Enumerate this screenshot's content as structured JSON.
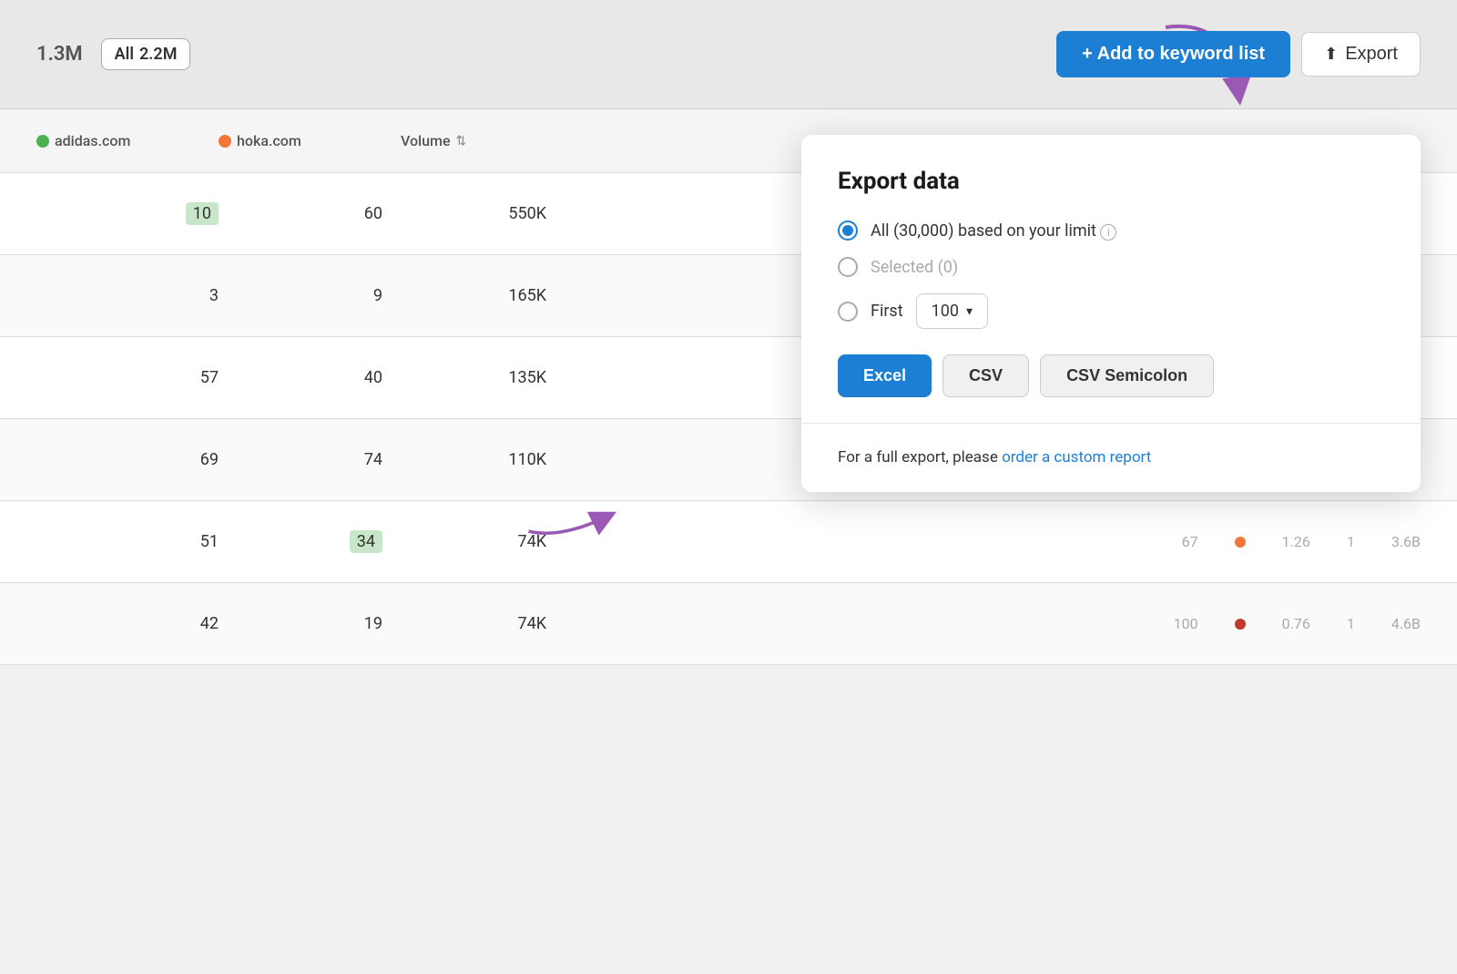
{
  "topbar": {
    "filter_count": "1.3M",
    "all_label": "All",
    "all_count": "2.2M",
    "add_keyword_label": "+ Add to keyword list",
    "export_label": "Export",
    "export_icon": "↑"
  },
  "table": {
    "headers": {
      "adidas": "adidas.com",
      "hoka": "hoka.com",
      "volume": "Volume"
    },
    "rows": [
      {
        "adidas": "10",
        "hoka": "60",
        "volume": "550K",
        "highlight_adidas": true,
        "highlight_hoka": false
      },
      {
        "adidas": "3",
        "hoka": "9",
        "volume": "165K",
        "highlight_adidas": false,
        "highlight_hoka": false
      },
      {
        "adidas": "57",
        "hoka": "40",
        "volume": "135K",
        "highlight_adidas": false,
        "highlight_hoka": false
      },
      {
        "adidas": "69",
        "hoka": "74",
        "volume": "110K",
        "highlight_adidas": false,
        "highlight_hoka": false
      },
      {
        "adidas": "51",
        "hoka": "34",
        "volume": "74K",
        "extra": "67  1.26  1  3.6B",
        "highlight_adidas": false,
        "highlight_hoka": true
      },
      {
        "adidas": "42",
        "hoka": "19",
        "volume": "74K",
        "extra": "100  0.76  1  4.6B",
        "highlight_adidas": false,
        "highlight_hoka": false
      }
    ]
  },
  "export_panel": {
    "title": "Export data",
    "option_all_label": "All (30,000) based on your limit",
    "option_selected_label": "Selected (0)",
    "option_first_label": "First",
    "first_value": "100",
    "btn_excel": "Excel",
    "btn_csv": "CSV",
    "btn_csv_semicolon": "CSV Semicolon",
    "footer_text": "For a full export, please ",
    "footer_link": "order a custom report"
  }
}
